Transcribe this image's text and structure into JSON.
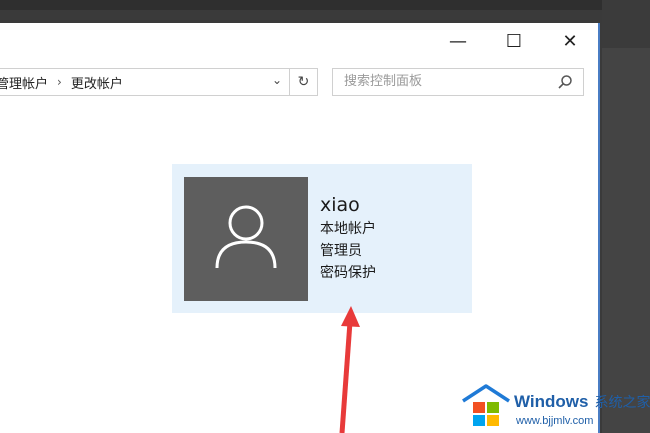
{
  "window": {
    "min_glyph": "—",
    "max_glyph": "☐",
    "close_glyph": "✕"
  },
  "address_bar": {
    "crumbs": [
      "管理帐户",
      "更改帐户"
    ],
    "separator": "›",
    "dropdown_glyph": "⌄",
    "refresh_glyph": "↻"
  },
  "search": {
    "placeholder": "搜索控制面板"
  },
  "account": {
    "name": "xiao",
    "type": "本地帐户",
    "role": "管理员",
    "protection": "密码保护"
  },
  "watermark": {
    "brand": "Windows",
    "brand_cn": "系统之家",
    "url": "www.bjjmlv.com"
  },
  "colors": {
    "card_bg": "#e5f1fb",
    "avatar_bg": "#5e5e5e",
    "arrow": "#e83a3a"
  }
}
